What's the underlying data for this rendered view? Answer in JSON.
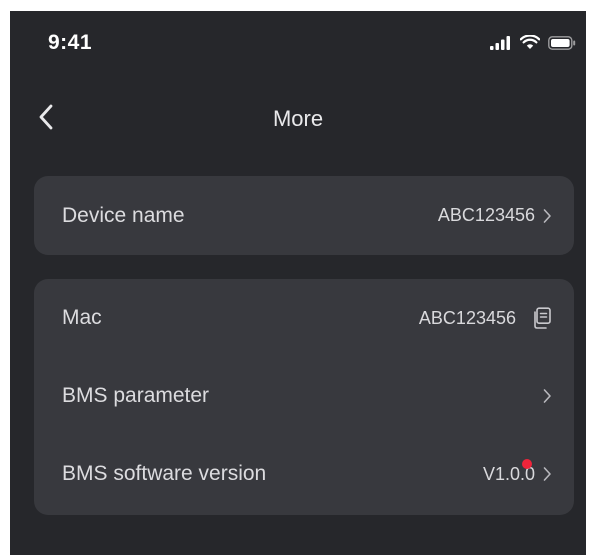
{
  "status_bar": {
    "time": "9:41",
    "icons": [
      "signal-icon",
      "wifi-icon",
      "battery-icon"
    ]
  },
  "nav": {
    "back_icon": "chevron-left-icon",
    "title": "More"
  },
  "settings": {
    "device_name": {
      "label": "Device name",
      "value": "ABC123456"
    },
    "mac": {
      "label": "Mac",
      "value": "ABC123456",
      "icon": "copy-icon"
    },
    "bms_parameter": {
      "label": "BMS parameter"
    },
    "bms_software_version": {
      "label": "BMS software version",
      "value": "V1.0.0",
      "badge": "update-dot"
    }
  },
  "colors": {
    "background": "#26272b",
    "card": "#38393e",
    "text": "#dcdcdf",
    "badge": "#f0243a"
  }
}
